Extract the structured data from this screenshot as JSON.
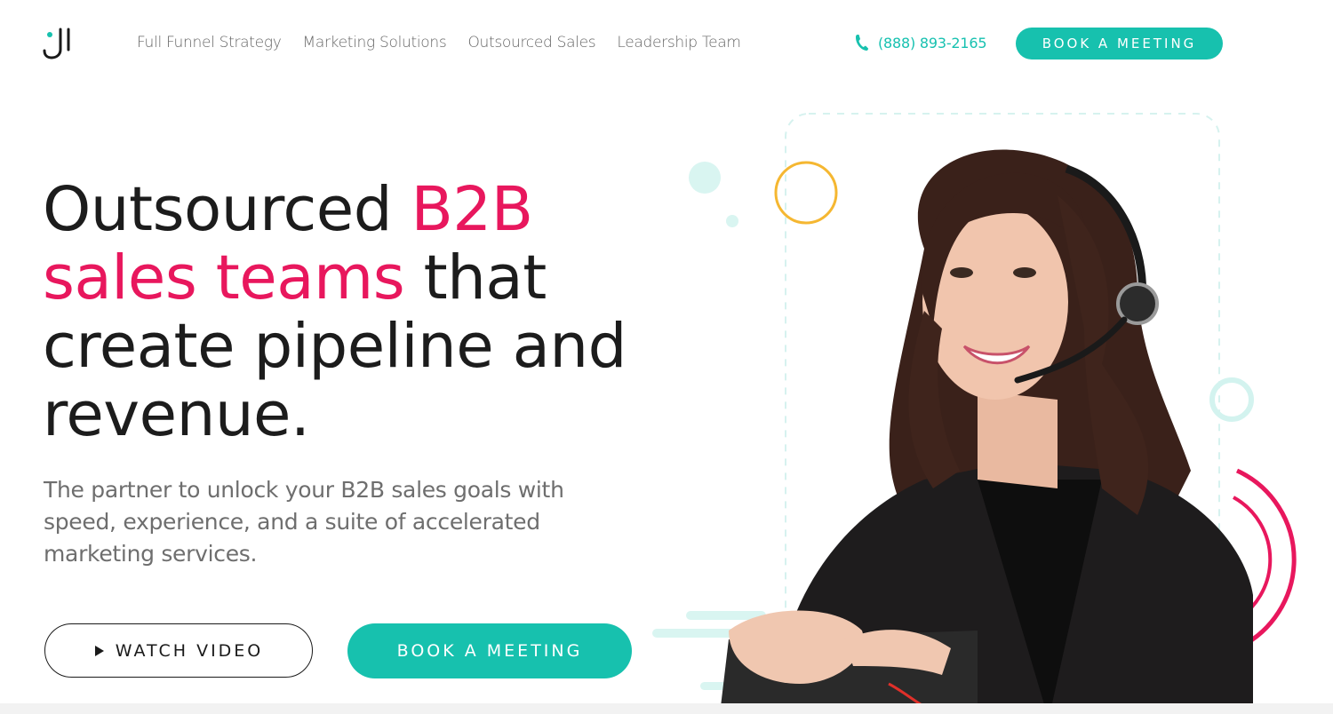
{
  "nav": {
    "items": [
      "Full Funnel Strategy",
      "Marketing Solutions",
      "Outsourced Sales",
      "Leadership Team"
    ],
    "phone": "(888) 893-2165",
    "cta": "BOOK A MEETING"
  },
  "hero": {
    "headline_part1": "Outsourced ",
    "headline_pink1": "B2B",
    "headline_pink2": "sales teams",
    "headline_part2": " that create pipeline and revenue.",
    "subcopy": "The partner to unlock your B2B sales goals with speed, experience, and a suite of accelerated marketing services.",
    "watch_video": "WATCH VIDEO",
    "book_meeting": "BOOK A MEETING"
  },
  "colors": {
    "accent": "#17c1ae",
    "pink": "#e8175d",
    "yellow": "#f5b731",
    "mint": "#d9f5f1"
  },
  "icons": {
    "logo": "j-logo-icon",
    "phone": "phone-icon",
    "play": "play-icon"
  }
}
